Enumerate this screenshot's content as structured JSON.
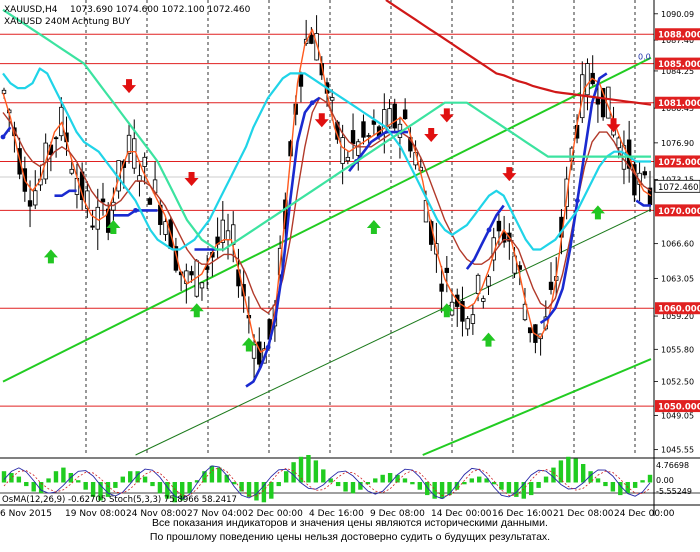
{
  "chart_data": {
    "type": "candlestick",
    "header": {
      "symbol_line": "XAUUSD,H4",
      "ohlc": "1073.690 1074.600 1072.100 1072.460",
      "indicator_line": "XAUUSD 240M",
      "signal": "Achtung BUY"
    },
    "price_axis": {
      "ticks": [
        1090.09,
        1087.4,
        1084.25,
        1080.45,
        1076.9,
        1073.15,
        1066.6,
        1063.05,
        1059.2,
        1055.8,
        1052.5,
        1049.05,
        1045.55
      ],
      "ylim": [
        1045.0,
        1091.5
      ]
    },
    "levels": [
      {
        "label": "1088.000",
        "value": 1088.0,
        "color": "#e02020",
        "label_color": "#ffffff",
        "label_bg": "#e02020"
      },
      {
        "label": "1085.000",
        "value": 1085.0,
        "color": "#e02020",
        "label_color": "#ffffff",
        "label_bg": "#e02020"
      },
      {
        "label": "1081.000",
        "value": 1081.0,
        "color": "#e02020",
        "label_color": "#ffffff",
        "label_bg": "#e02020"
      },
      {
        "label": "1075.000",
        "value": 1075.0,
        "color": "#e02020",
        "label_color": "#ffffff",
        "label_bg": "#e02020"
      },
      {
        "label": "1070.000",
        "value": 1070.0,
        "color": "#e02020",
        "label_color": "#ffffff",
        "label_bg": "#e02020"
      },
      {
        "label": "1060.000",
        "value": 1060.0,
        "color": "#e02020",
        "label_color": "#ffffff",
        "label_bg": "#e02020"
      },
      {
        "label": "1050.000",
        "value": 1050.0,
        "color": "#e02020",
        "label_color": "#ffffff",
        "label_bg": "#e02020"
      }
    ],
    "current_price": {
      "label": "1072.460",
      "value": 1072.46
    },
    "fib_marker": {
      "label": "0.0",
      "value": 1085.2
    },
    "x_axis": {
      "labels": [
        "6 Nov 2015",
        "19 Nov 08:00",
        "24 Nov 08:00",
        "27 Nov 04:00",
        "2 Dec 00:00",
        "4 Dec 16:00",
        "9 Dec 08:00",
        "14 Dec 00:00",
        "16 Dec 16:00",
        "21 Dec 08:00",
        "24 Dec 00:00"
      ]
    },
    "series": [
      {
        "color": "#ff5a1e",
        "y": [
          1082,
          1079.5,
          1076,
          1073,
          1072,
          1073,
          1075.5,
          1078,
          1079,
          1076,
          1073.5,
          1071,
          1069.5,
          1069,
          1069.5,
          1071.5,
          1074,
          1076,
          1076,
          1074,
          1072.5,
          1071,
          1069.5,
          1067,
          1064,
          1062.5,
          1063,
          1063.5,
          1065,
          1066.5,
          1067,
          1067,
          1064,
          1060.5,
          1057,
          1055.5,
          1056,
          1060,
          1067,
          1075,
          1083,
          1087,
          1088.5,
          1086,
          1082,
          1078.5,
          1076.5,
          1076,
          1076.5,
          1077,
          1077.5,
          1078,
          1078.5,
          1079,
          1079.5,
          1078.5,
          1076,
          1073,
          1069,
          1065.5,
          1063,
          1061.5,
          1060.5,
          1060,
          1060.5,
          1062,
          1064,
          1066.5,
          1068,
          1067,
          1064,
          1060.5,
          1057.5,
          1057,
          1058.5,
          1062.5,
          1068,
          1074,
          1079,
          1082.5,
          1083.5,
          1083,
          1081,
          1079,
          1077,
          1075.5,
          1073.5,
          1072,
          1071.5
        ]
      },
      {
        "color": "#b23a2a",
        "y": [
          1080,
          1079,
          1077.5,
          1076,
          1075,
          1074.5,
          1075,
          1076,
          1076.5,
          1076,
          1075,
          1073.5,
          1072,
          1071,
          1070.5,
          1070.5,
          1071,
          1072,
          1073,
          1073,
          1072.5,
          1071.5,
          1070.5,
          1069,
          1067.5,
          1066,
          1065,
          1064.5,
          1064.5,
          1065,
          1065.5,
          1065.5,
          1065,
          1063.5,
          1061.5,
          1060,
          1059.5,
          1060.5,
          1063,
          1067,
          1072,
          1076.5,
          1080,
          1081.5,
          1081,
          1079.5,
          1078,
          1077,
          1076.5,
          1076.5,
          1076.5,
          1077,
          1077.5,
          1078,
          1078,
          1077.5,
          1076.5,
          1075,
          1073,
          1071,
          1069,
          1067.5,
          1066,
          1065,
          1064.5,
          1064.5,
          1065,
          1066,
          1067,
          1067,
          1066,
          1064,
          1062,
          1060.5,
          1060,
          1061,
          1063.5,
          1067,
          1071,
          1074.5,
          1077,
          1078,
          1078,
          1077,
          1075.5,
          1074.5,
          1073.5,
          1072.5,
          1072
        ]
      },
      {
        "color": "#1a2ad0",
        "y": [
          1077.5,
          1078.5,
          null,
          null,
          null,
          null,
          null,
          1071.5,
          1071.5,
          1072,
          1072,
          null,
          null,
          null,
          null,
          1069.5,
          1069.5,
          1069.5,
          1070,
          1070,
          1070,
          1070,
          null,
          null,
          null,
          null,
          1066,
          1066,
          1066,
          1066,
          null,
          null,
          null,
          1052,
          1052.5,
          1054,
          1056,
          1059,
          1064,
          1071,
          1077,
          1080,
          1081,
          1081.5,
          null,
          null,
          null,
          1074,
          1075,
          1076,
          1077,
          1077.5,
          1078,
          1078,
          1078,
          1078,
          null,
          null,
          null,
          null,
          null,
          null,
          null,
          1064,
          1065,
          1066.5,
          1068,
          1069.5,
          1070.5,
          null,
          null,
          null,
          null,
          1058.5,
          1059,
          1060,
          1062,
          1066,
          1071,
          1076,
          1081,
          1083.5,
          1084,
          null,
          null,
          null,
          1071,
          1070.5,
          1070.5
        ]
      },
      {
        "color": "#20d4e8",
        "y": [
          1084,
          1083,
          1082.5,
          1082.5,
          1083,
          1084.5,
          1084,
          1082.5,
          1081,
          1079.5,
          1078,
          1077,
          1076.5,
          1076,
          1075,
          1074,
          1073,
          1072,
          1071,
          1069.5,
          1068,
          1067,
          1066.5,
          1066,
          1066,
          1066.5,
          1067,
          1068,
          1069,
          1070.5,
          1072,
          1073.5,
          1075,
          1076.5,
          1078.5,
          1080,
          1081.5,
          1082.5,
          1083.5,
          1084,
          1084,
          1084,
          1083.5,
          1083,
          1082.5,
          1082,
          1081.5,
          1081,
          1080.5,
          1080,
          1079.5,
          1079,
          1078.5,
          1077.5,
          1076.5,
          1075,
          1073.5,
          1072,
          1070.5,
          1069,
          1068,
          1067.5,
          1068,
          1068.5,
          1069.5,
          1070.5,
          1071.5,
          1072,
          1071.5,
          1070,
          1068.5,
          1067,
          1066,
          1066,
          1066.5,
          1067,
          1068,
          1069,
          1070,
          1071.5,
          1073,
          1074.5,
          1075.5,
          1076,
          1076,
          1075.5,
          1075,
          1075,
          1075
        ]
      },
      {
        "color": "#3ce3a0",
        "y": [
          1090.5,
          1090,
          1089.5,
          1089,
          1088.5,
          1088,
          1087.5,
          1087,
          1086.5,
          1086,
          1085.5,
          1085,
          1084,
          1083,
          1082,
          1081,
          1080,
          1079,
          1078,
          1077,
          1076,
          1075,
          1073.5,
          1072,
          1070.5,
          1069,
          1068,
          1067,
          1066.5,
          1066,
          1066,
          1066.5,
          1067,
          1067.5,
          1068,
          1068.5,
          1069,
          1069.5,
          1070,
          1070.5,
          1071,
          1071.5,
          1072,
          1072.5,
          1073,
          1073.5,
          1074,
          1074.5,
          1075,
          1075.5,
          1076,
          1076.5,
          1077,
          1077.5,
          1078,
          1078.5,
          1079,
          1079.5,
          1080,
          1080.5,
          1081,
          1081,
          1081,
          1081,
          1080.5,
          1080,
          1079.5,
          1079,
          1078.5,
          1078,
          1077.5,
          1077,
          1076.5,
          1076,
          1075.5,
          1075.5,
          1075.5,
          1075.5,
          1075.5,
          1075.5,
          1075.5,
          1075.5,
          1075.5,
          1075.5,
          1075.5,
          1075.5,
          1075.5,
          1075.5,
          1075.5
        ]
      },
      {
        "color": "#d01818",
        "y": [
          null,
          null,
          null,
          null,
          null,
          null,
          null,
          null,
          null,
          null,
          null,
          null,
          null,
          null,
          null,
          null,
          null,
          null,
          null,
          null,
          null,
          null,
          null,
          null,
          null,
          null,
          null,
          null,
          null,
          null,
          null,
          null,
          null,
          null,
          null,
          null,
          null,
          null,
          null,
          null,
          null,
          null,
          null,
          null,
          null,
          null,
          null,
          null,
          null,
          null,
          null,
          null,
          1091.5,
          1091,
          1090.5,
          1090,
          1089.5,
          1089,
          1088.5,
          1088,
          1087.5,
          1087,
          1086.5,
          1086,
          1085.5,
          1085,
          1084.5,
          1084,
          1083.8,
          1083.5,
          1083.2,
          1083,
          1082.7,
          1082.5,
          1082.3,
          1082.1,
          1082,
          1081.9,
          1081.8,
          1081.7,
          1081.6,
          1081.5,
          1081.4,
          1081.3,
          1081.2,
          1081.1,
          1081,
          1080.9,
          1080.8
        ]
      }
    ],
    "trend_lines": [
      {
        "color": "#22cc22",
        "x": [
          0,
          88
        ],
        "y": [
          1052.5,
          1085.6
        ]
      },
      {
        "color": "#22cc22",
        "x": [
          57,
          88
        ],
        "y": [
          1045.0,
          1054.8
        ]
      },
      {
        "color": "#1c7a1c",
        "x": [
          18,
          88
        ],
        "y": [
          1045.0,
          1070.1
        ]
      }
    ],
    "sell_arrows": [
      {
        "x": 24,
        "y": 1082.5
      },
      {
        "x": 36,
        "y": 1073
      },
      {
        "x": 61,
        "y": 1079
      },
      {
        "x": 82,
        "y": 1077.5
      },
      {
        "x": 85,
        "y": 1079.5
      },
      {
        "x": 97,
        "y": 1073.5
      },
      {
        "x": 117,
        "y": 1078.5
      }
    ],
    "buy_arrows": [
      {
        "x": 9,
        "y": 1065.5
      },
      {
        "x": 21,
        "y": 1068.5
      },
      {
        "x": 37,
        "y": 1060
      },
      {
        "x": 47,
        "y": 1056.5
      },
      {
        "x": 71,
        "y": 1068.5
      },
      {
        "x": 85,
        "y": 1060
      },
      {
        "x": 93,
        "y": 1057
      },
      {
        "x": 114,
        "y": 1070
      }
    ],
    "oscillator": {
      "label": "OsMA(12,26,9) -0.62705  Stoch(5,3,3) 75.8966 58.2417",
      "ticks": [
        "4.76698",
        "0.00",
        "-5.55249"
      ],
      "hist": [
        0.6,
        0.5,
        0.3,
        -0.2,
        -0.5,
        -0.6,
        0.2,
        0.6,
        0.8,
        0.5,
        0.1,
        -0.4,
        -0.8,
        -1.0,
        -0.8,
        -0.3,
        0.3,
        0.6,
        0.6,
        0.3,
        -0.2,
        -0.6,
        -0.9,
        -1.1,
        -1.0,
        -0.6,
        0.1,
        0.6,
        0.9,
        0.8,
        0.4,
        -0.1,
        -0.5,
        -0.8,
        -1.0,
        -1.1,
        -0.9,
        -0.2,
        0.6,
        1.1,
        1.4,
        1.5,
        1.2,
        0.7,
        0.2,
        -0.2,
        -0.5,
        -0.6,
        -0.4,
        -0.1,
        0.2,
        0.4,
        0.5,
        0.4,
        0.2,
        -0.1,
        -0.4,
        -0.7,
        -0.9,
        -0.9,
        -0.7,
        -0.4,
        -0.1,
        0.2,
        0.3,
        0.2,
        -0.1,
        -0.4,
        -0.6,
        -0.8,
        -0.9,
        -0.7,
        -0.3,
        0.3,
        0.8,
        1.2,
        1.4,
        1.3,
        1.0,
        0.6,
        0.2,
        -0.2,
        -0.5,
        -0.7,
        -0.6,
        -0.3,
        0.1,
        0.4
      ]
    },
    "disclaimer": [
      "Все показания индикаторов и значения цены являются историческими данными.",
      "По прошлому поведению цены нельзя достоверно судить о будущих результатах."
    ]
  }
}
